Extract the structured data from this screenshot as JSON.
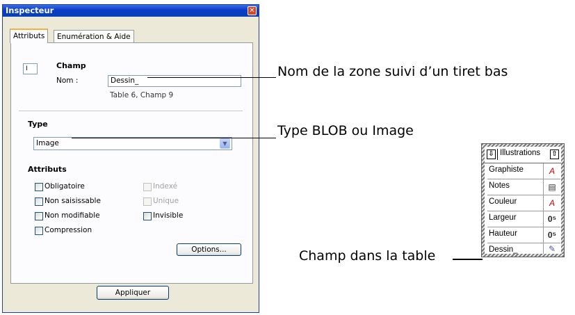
{
  "window": {
    "title": "Inspecteur",
    "close": "✕"
  },
  "tabs": [
    {
      "label": "Attributs"
    },
    {
      "label": "Enumération & Aide"
    }
  ],
  "champ": {
    "number_value": "I",
    "heading": "Champ",
    "name_label": "Nom :",
    "name_value": "Dessin_",
    "location": "Table 6, Champ 9"
  },
  "type": {
    "heading": "Type",
    "selected": "Image"
  },
  "attributes": {
    "heading": "Attributs",
    "left": [
      {
        "label": "Obligatoire",
        "checked": false,
        "enabled": true
      },
      {
        "label": "Non saisissable",
        "checked": false,
        "enabled": true
      },
      {
        "label": "Non modifiable",
        "checked": false,
        "enabled": true
      },
      {
        "label": "Compression",
        "checked": false,
        "enabled": true
      }
    ],
    "right": [
      {
        "label": "Indexé",
        "checked": false,
        "enabled": false
      },
      {
        "label": "Unique",
        "checked": false,
        "enabled": false
      },
      {
        "label": "Invisible",
        "checked": false,
        "enabled": true
      }
    ]
  },
  "buttons": {
    "options": "Options...",
    "apply": "Appliquer"
  },
  "callouts": {
    "name": "Nom de la zone suivi d’un tiret bas",
    "type": "Type BLOB ou Image",
    "field": "Champ dans la table"
  },
  "table_widget": {
    "title": "Illustrations",
    "fields": [
      {
        "name": "Graphiste",
        "icon": "text-field-icon",
        "glyph": "A"
      },
      {
        "name": "Notes",
        "icon": "text-block-icon",
        "glyph": "▤"
      },
      {
        "name": "Couleur",
        "icon": "text-field-icon",
        "glyph": "A"
      },
      {
        "name": "Largeur",
        "icon": "numeric-field-icon",
        "glyph": "0⁵"
      },
      {
        "name": "Hauteur",
        "icon": "numeric-field-icon",
        "glyph": "0⁵"
      },
      {
        "name": "Dessin_",
        "icon": "picture-field-icon",
        "glyph": "✎"
      }
    ]
  }
}
